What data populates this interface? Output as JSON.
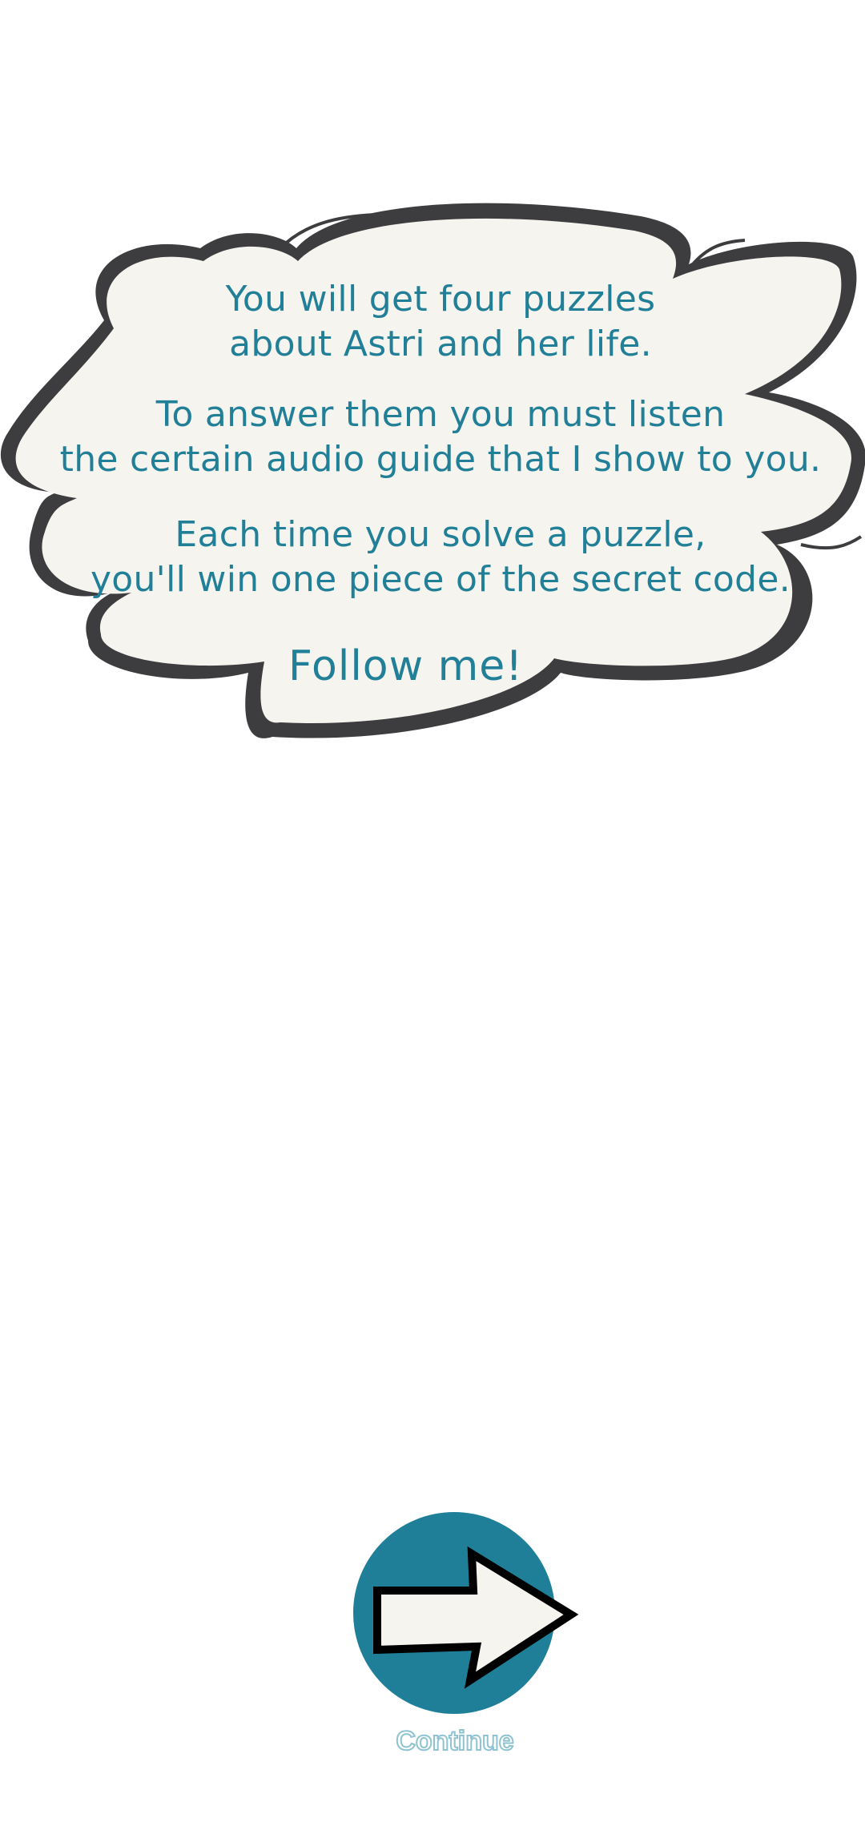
{
  "speech": {
    "paragraph1": [
      "You will get four puzzles",
      "about Astri and her life."
    ],
    "paragraph2": [
      "To answer them you must listen",
      "the certain audio guide that I show to you."
    ],
    "paragraph3": [
      "Each time you solve a puzzle,",
      "you'll win one piece of the secret code."
    ],
    "follow": "Follow me!"
  },
  "continue_button": {
    "icon": "arrow-right-icon",
    "label": "Continue"
  },
  "colors": {
    "text": "#217f97",
    "button": "#1f7f99",
    "cloud_fill": "#f5f4ef",
    "cloud_outline": "#3d3d3f",
    "arrow_fill": "#f5f4ef"
  }
}
